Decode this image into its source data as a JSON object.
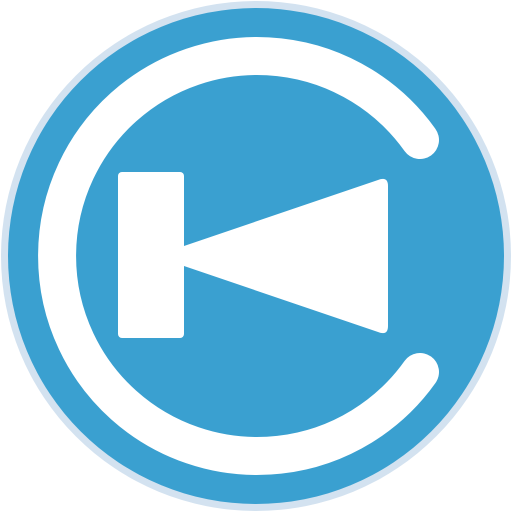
{
  "icon": {
    "name": "app-logo-icon",
    "colors": {
      "background": "#ffffff",
      "halo": "#d3e2f0",
      "badge": "#3aa0d0",
      "symbol": "#ffffff"
    }
  }
}
